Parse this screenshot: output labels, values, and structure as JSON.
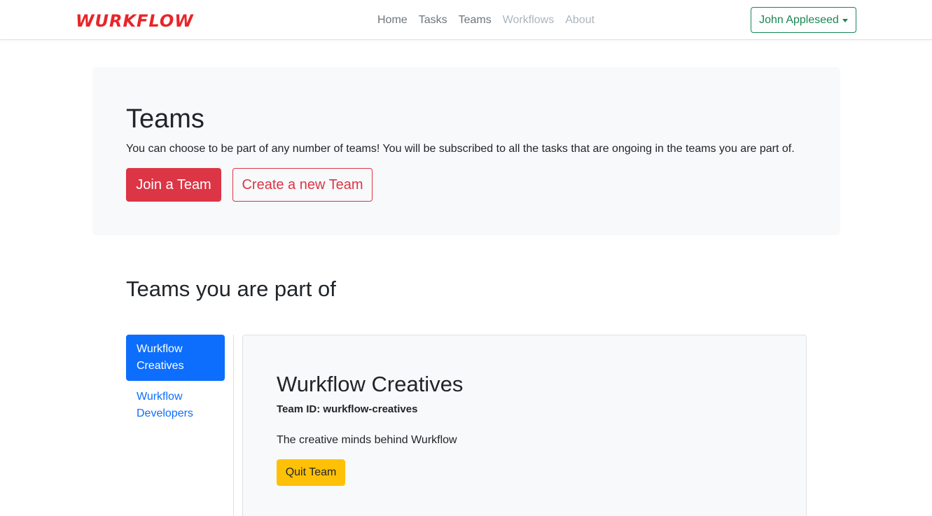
{
  "brand": {
    "name": "WURKFLOW"
  },
  "nav": {
    "links": [
      {
        "label": "Home",
        "state": "default"
      },
      {
        "label": "Tasks",
        "state": "default"
      },
      {
        "label": "Teams",
        "state": "default"
      },
      {
        "label": "Workflows",
        "state": "muted"
      },
      {
        "label": "About",
        "state": "muted"
      }
    ],
    "user": {
      "label": "John Appleseed",
      "icon": "caret-down-icon"
    }
  },
  "hero": {
    "title": "Teams",
    "description": "You can choose to be part of any number of teams! You will be subscribed to all the tasks that are ongoing in the teams you are part of.",
    "join_button": "Join a Team",
    "create_button": "Create a new Team"
  },
  "teams_section": {
    "title": "Teams you are part of",
    "teams": [
      {
        "label": "Wurkflow Creatives",
        "active": true
      },
      {
        "label": "Wurkflow Developers",
        "active": false
      }
    ]
  },
  "selected_team": {
    "name": "Wurkflow Creatives",
    "id_text": "Team ID: wurkflow-creatives",
    "description": "The creative minds behind Wurkflow",
    "quit_button": "Quit Team"
  },
  "colors": {
    "brand": "#e8252a",
    "danger": "#dc3545",
    "primary": "#0d6efd",
    "success": "#198754",
    "warning": "#ffc107",
    "light_bg": "#f8f9fa"
  }
}
